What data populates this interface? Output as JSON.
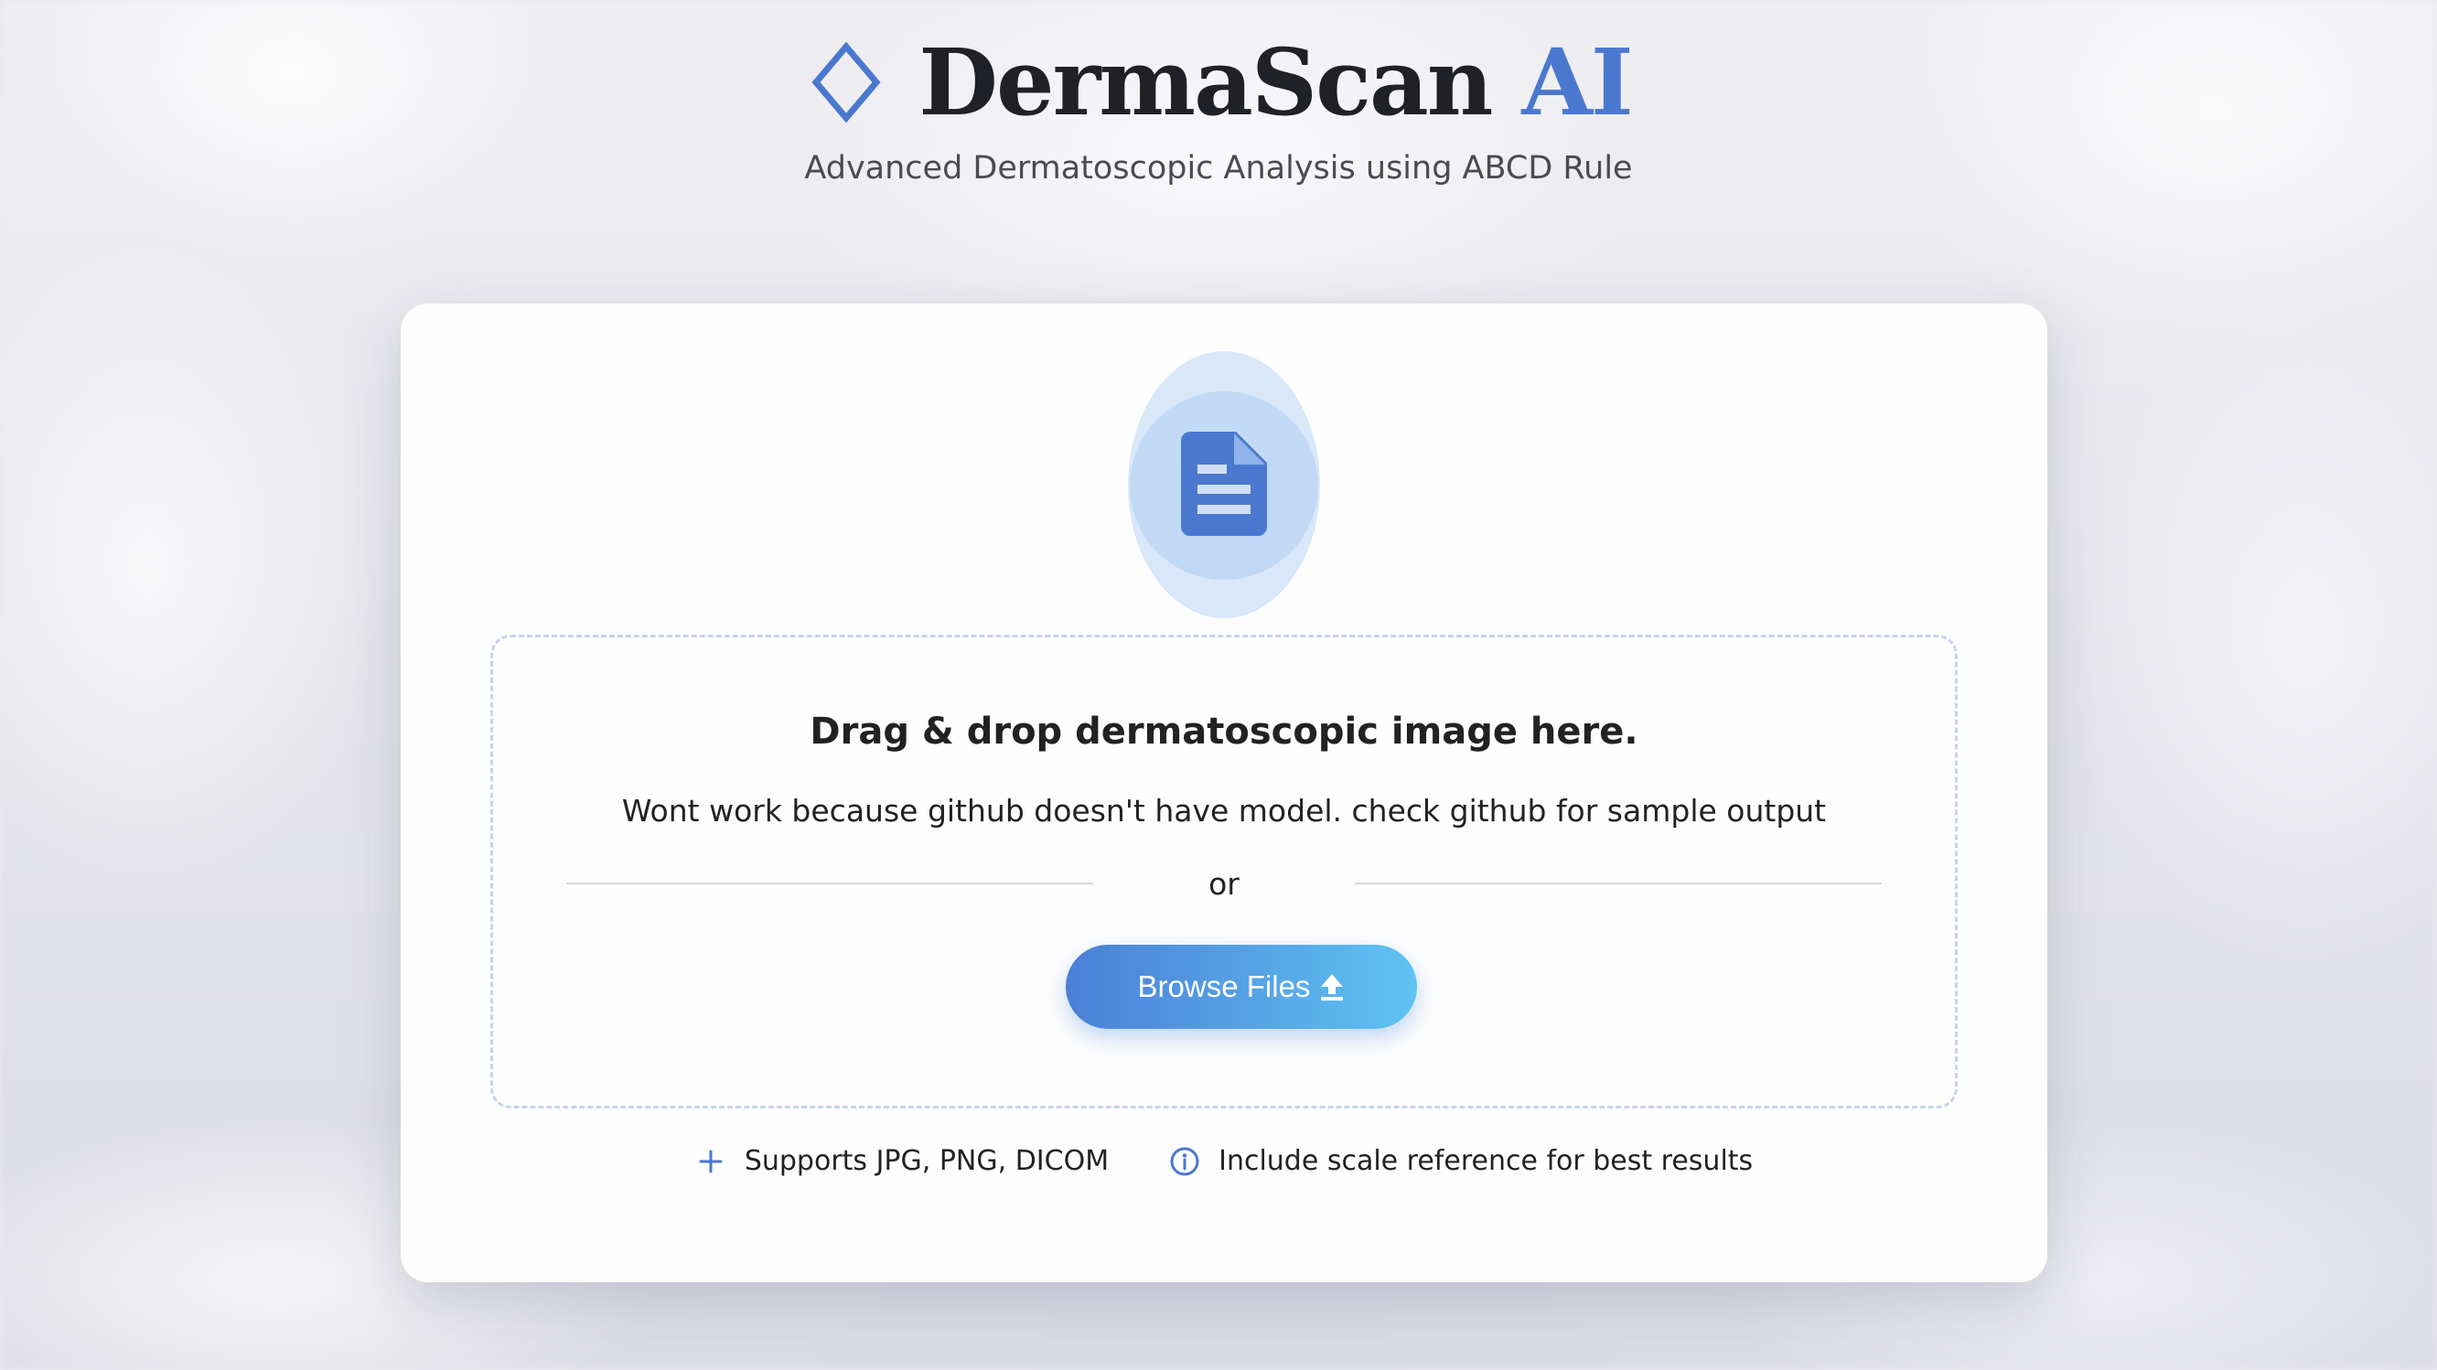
{
  "header": {
    "title_main": "DermaScan",
    "title_accent": "AI",
    "subtitle": "Advanced Dermatoscopic Analysis using ABCD Rule",
    "logo_icon": "diamond-icon"
  },
  "upload": {
    "badge_icon": "document-icon",
    "drop_title": "Drag & drop dermatoscopic image here.",
    "drop_note": "Wont work because github doesn't have model. check github for sample output",
    "or_text": "or",
    "browse_label": "Browse Files",
    "browse_icon": "upload-icon"
  },
  "hints": [
    {
      "icon": "plus-icon",
      "text": "Supports JPG, PNG, DICOM"
    },
    {
      "icon": "info-icon",
      "text": "Include scale reference for best results"
    }
  ],
  "colors": {
    "accent": "#4b78cf",
    "button_start": "#4b7fd6",
    "button_end": "#5fc3f2",
    "text": "#222222"
  }
}
